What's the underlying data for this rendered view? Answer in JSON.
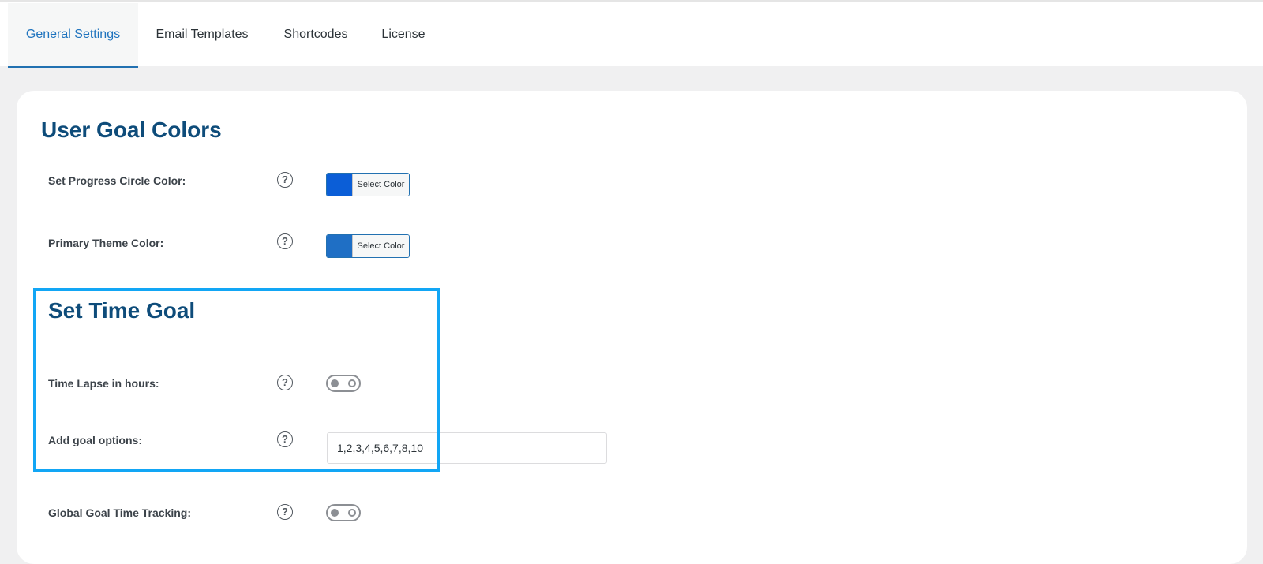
{
  "tabs": [
    {
      "label": "General Settings",
      "active": true
    },
    {
      "label": "Email Templates",
      "active": false
    },
    {
      "label": "Shortcodes",
      "active": false
    },
    {
      "label": "License",
      "active": false
    }
  ],
  "sections": {
    "user_goal_colors": {
      "title": "User Goal Colors",
      "rows": [
        {
          "label": "Set Progress Circle Color:",
          "button_label": "Select Color",
          "color": "#0b5ed7"
        },
        {
          "label": "Primary Theme Color:",
          "button_label": "Select Color",
          "color": "#1f6fc5"
        }
      ]
    },
    "set_time_goal": {
      "title": "Set Time Goal",
      "time_lapse": {
        "label": "Time Lapse in hours:",
        "enabled": false
      },
      "goal_options": {
        "label": "Add goal options:",
        "value": "1,2,3,4,5,6,7,8,10"
      }
    },
    "global_tracking": {
      "label": "Global Goal Time Tracking:",
      "enabled": false
    }
  },
  "help_icon_glyph": "?",
  "colors": {
    "accent": "#1e73be",
    "heading": "#0e4c7a",
    "highlight": "#12a6f5",
    "background": "#f0f0f1"
  }
}
